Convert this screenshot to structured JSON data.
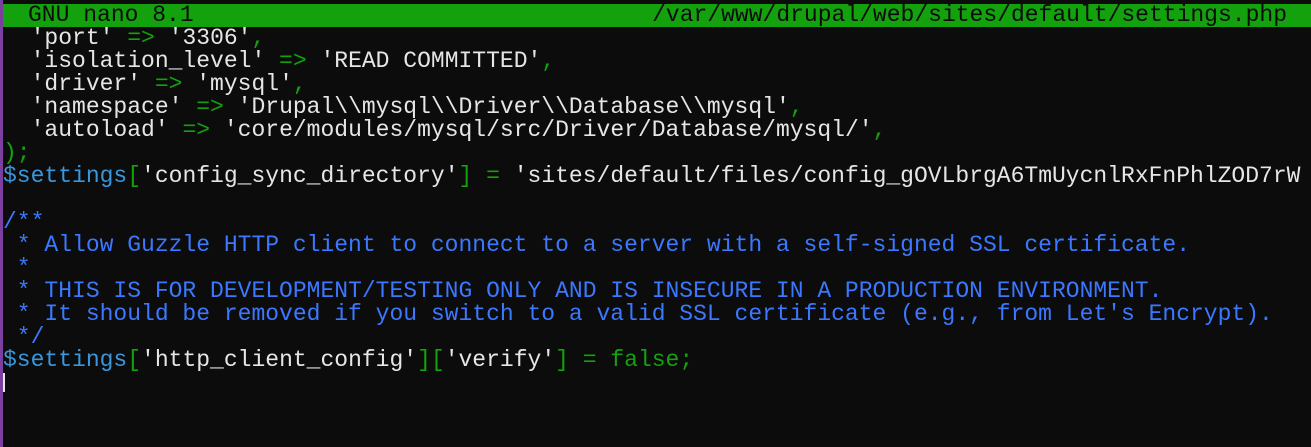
{
  "titlebar": {
    "app": "GNU nano 8.1",
    "file": "/var/www/drupal/web/sites/default/settings.php"
  },
  "editor": {
    "lines": [
      [
        {
          "t": "  ",
          "c": "white"
        },
        {
          "t": "'port'",
          "c": "white"
        },
        {
          "t": " => ",
          "c": "green"
        },
        {
          "t": "'3306'",
          "c": "white"
        },
        {
          "t": ",",
          "c": "green"
        }
      ],
      [
        {
          "t": "  ",
          "c": "white"
        },
        {
          "t": "'isolation_level'",
          "c": "white"
        },
        {
          "t": " => ",
          "c": "green"
        },
        {
          "t": "'READ COMMITTED'",
          "c": "white"
        },
        {
          "t": ",",
          "c": "green"
        }
      ],
      [
        {
          "t": "  ",
          "c": "white"
        },
        {
          "t": "'driver'",
          "c": "white"
        },
        {
          "t": " => ",
          "c": "green"
        },
        {
          "t": "'mysql'",
          "c": "white"
        },
        {
          "t": ",",
          "c": "green"
        }
      ],
      [
        {
          "t": "  ",
          "c": "white"
        },
        {
          "t": "'namespace'",
          "c": "white"
        },
        {
          "t": " => ",
          "c": "green"
        },
        {
          "t": "'Drupal\\\\mysql\\\\Driver\\\\Database\\\\mysql'",
          "c": "white"
        },
        {
          "t": ",",
          "c": "green"
        }
      ],
      [
        {
          "t": "  ",
          "c": "white"
        },
        {
          "t": "'autoload'",
          "c": "white"
        },
        {
          "t": " => ",
          "c": "green"
        },
        {
          "t": "'core/modules/mysql/src/Driver/Database/mysql/'",
          "c": "white"
        },
        {
          "t": ",",
          "c": "green"
        }
      ],
      [
        {
          "t": ");",
          "c": "green"
        }
      ],
      [
        {
          "t": "$settings",
          "c": "code"
        },
        {
          "t": "[",
          "c": "green"
        },
        {
          "t": "'config_sync_directory'",
          "c": "white"
        },
        {
          "t": "] = ",
          "c": "green"
        },
        {
          "t": "'sites/default/files/config_gOVLbrgA6TmUycnlRxFnPhlZOD7rW",
          "c": "white"
        }
      ],
      [],
      [
        {
          "t": "/**",
          "c": "blue"
        }
      ],
      [
        {
          "t": " * Allow Guzzle HTTP client to connect to a server with a self-signed SSL certificate.",
          "c": "blue"
        }
      ],
      [
        {
          "t": " *",
          "c": "blue"
        }
      ],
      [
        {
          "t": " * THIS IS FOR DEVELOPMENT/TESTING ONLY AND IS INSECURE IN A PRODUCTION ENVIRONMENT.",
          "c": "blue"
        }
      ],
      [
        {
          "t": " * It should be removed if you switch to a valid SSL certificate (e.g., from Let's Encrypt).",
          "c": "blue"
        }
      ],
      [
        {
          "t": " */",
          "c": "blue"
        }
      ],
      [
        {
          "t": "$settings",
          "c": "code"
        },
        {
          "t": "[",
          "c": "green"
        },
        {
          "t": "'http_client_config'",
          "c": "white"
        },
        {
          "t": "][",
          "c": "green"
        },
        {
          "t": "'verify'",
          "c": "white"
        },
        {
          "t": "] = false;",
          "c": "green"
        }
      ],
      []
    ],
    "cursor_line": 15
  }
}
